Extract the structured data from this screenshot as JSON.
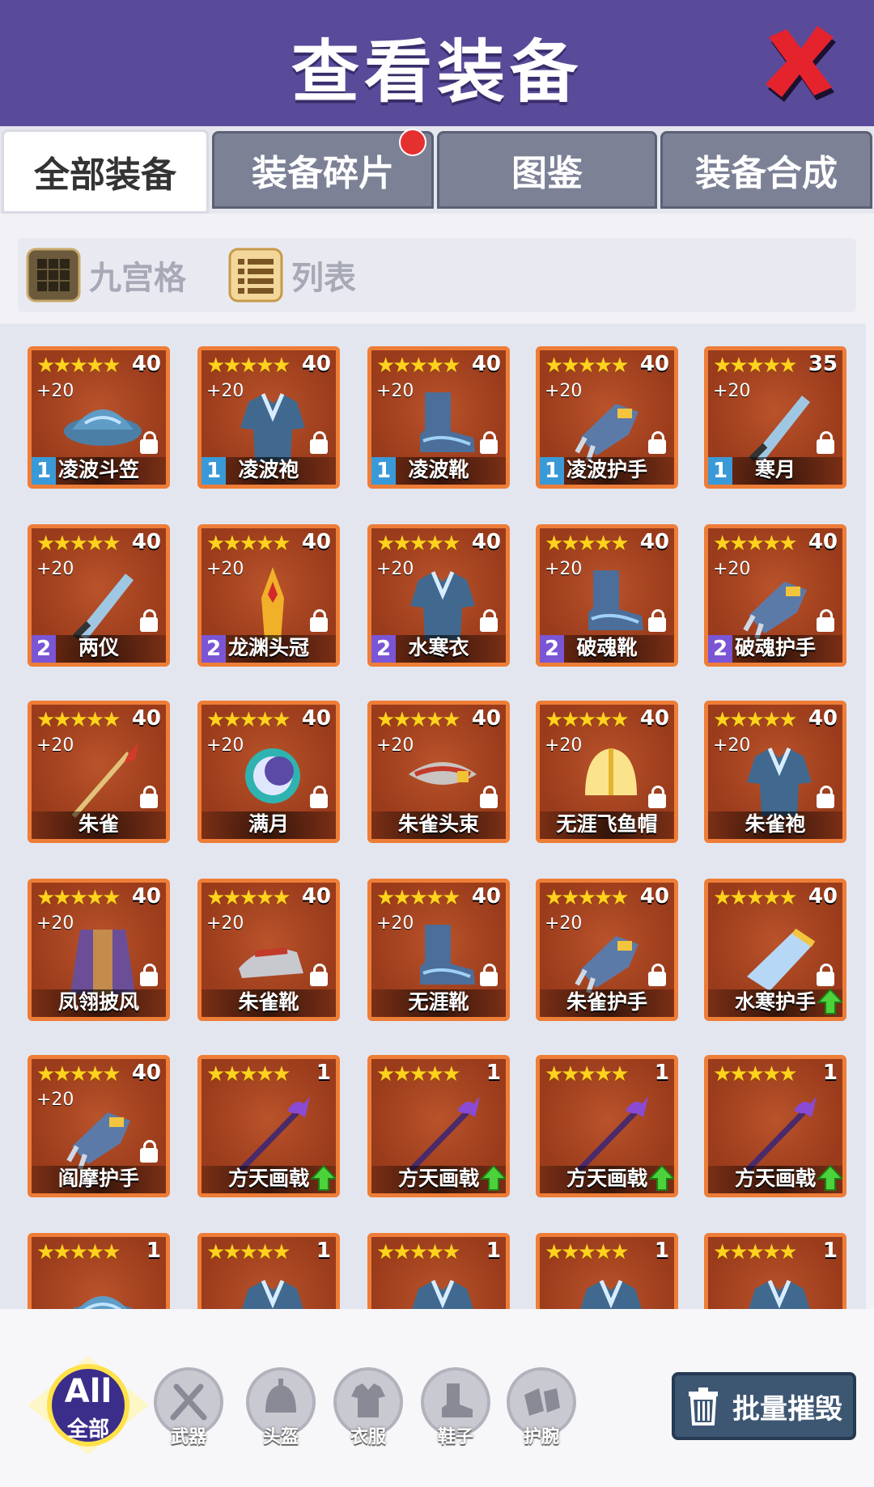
{
  "header": {
    "title": "查看装备"
  },
  "tabs": [
    {
      "label": "全部装备",
      "active": true
    },
    {
      "label": "装备碎片",
      "badge": true
    },
    {
      "label": "图鉴"
    },
    {
      "label": "装备合成"
    }
  ],
  "view_modes": [
    {
      "label": "九宫格",
      "icon": "grid-icon"
    },
    {
      "label": "列表",
      "icon": "list-icon"
    }
  ],
  "items": [
    {
      "name": "凌波斗笠",
      "level": "40",
      "enhance": "+20",
      "tier": "1",
      "stars": "★★★★★",
      "locked": true,
      "upgrade": false,
      "art": "hat"
    },
    {
      "name": "凌波袍",
      "level": "40",
      "enhance": "+20",
      "tier": "1",
      "stars": "★★★★★",
      "locked": true,
      "upgrade": false,
      "art": "robe"
    },
    {
      "name": "凌波靴",
      "level": "40",
      "enhance": "+20",
      "tier": "1",
      "stars": "★★★★★",
      "locked": true,
      "upgrade": false,
      "art": "boot"
    },
    {
      "name": "凌波护手",
      "level": "40",
      "enhance": "+20",
      "tier": "1",
      "stars": "★★★★★",
      "locked": true,
      "upgrade": false,
      "art": "glove"
    },
    {
      "name": "寒月",
      "level": "35",
      "enhance": "+20",
      "tier": "1",
      "stars": "★★★★★",
      "locked": true,
      "upgrade": false,
      "art": "sword"
    },
    {
      "name": "两仪",
      "level": "40",
      "enhance": "+20",
      "tier": "2",
      "stars": "★★★★★",
      "locked": true,
      "upgrade": false,
      "art": "sword"
    },
    {
      "name": "龙渊头冠",
      "level": "40",
      "enhance": "+20",
      "tier": "2",
      "stars": "★★★★★",
      "locked": true,
      "upgrade": false,
      "art": "crown"
    },
    {
      "name": "水寒衣",
      "level": "40",
      "enhance": "+20",
      "tier": "2",
      "stars": "★★★★★",
      "locked": true,
      "upgrade": false,
      "art": "robe"
    },
    {
      "name": "破魂靴",
      "level": "40",
      "enhance": "+20",
      "tier": "2",
      "stars": "★★★★★",
      "locked": true,
      "upgrade": false,
      "art": "boot"
    },
    {
      "name": "破魂护手",
      "level": "40",
      "enhance": "+20",
      "tier": "2",
      "stars": "★★★★★",
      "locked": true,
      "upgrade": false,
      "art": "glove"
    },
    {
      "name": "朱雀",
      "level": "40",
      "enhance": "+20",
      "tier": "",
      "stars": "★★★★★",
      "locked": true,
      "upgrade": false,
      "art": "spear"
    },
    {
      "name": "满月",
      "level": "40",
      "enhance": "+20",
      "tier": "",
      "stars": "★★★★★",
      "locked": true,
      "upgrade": false,
      "art": "moon"
    },
    {
      "name": "朱雀头束",
      "level": "40",
      "enhance": "+20",
      "tier": "",
      "stars": "★★★★★",
      "locked": true,
      "upgrade": false,
      "art": "band"
    },
    {
      "name": "无涯飞鱼帽",
      "level": "40",
      "enhance": "+20",
      "tier": "",
      "stars": "★★★★★",
      "locked": true,
      "upgrade": false,
      "art": "helmet"
    },
    {
      "name": "朱雀袍",
      "level": "40",
      "enhance": "+20",
      "tier": "",
      "stars": "★★★★★",
      "locked": true,
      "upgrade": false,
      "art": "robe"
    },
    {
      "name": "凤翎披风",
      "level": "40",
      "enhance": "+20",
      "tier": "",
      "stars": "★★★★★",
      "locked": true,
      "upgrade": false,
      "art": "cape"
    },
    {
      "name": "朱雀靴",
      "level": "40",
      "enhance": "+20",
      "tier": "",
      "stars": "★★★★★",
      "locked": true,
      "upgrade": false,
      "art": "shoe"
    },
    {
      "name": "无涯靴",
      "level": "40",
      "enhance": "+20",
      "tier": "",
      "stars": "★★★★★",
      "locked": true,
      "upgrade": false,
      "art": "boot"
    },
    {
      "name": "朱雀护手",
      "level": "40",
      "enhance": "+20",
      "tier": "",
      "stars": "★★★★★",
      "locked": true,
      "upgrade": false,
      "art": "glove"
    },
    {
      "name": "水寒护手",
      "level": "40",
      "enhance": "",
      "tier": "",
      "stars": "★★★★★",
      "locked": true,
      "upgrade": true,
      "art": "gem"
    },
    {
      "name": "阎摩护手",
      "level": "40",
      "enhance": "+20",
      "tier": "",
      "stars": "★★★★★",
      "locked": true,
      "upgrade": false,
      "art": "glove"
    },
    {
      "name": "方天画戟",
      "level": "1",
      "enhance": "",
      "tier": "",
      "stars": "★★★★★",
      "locked": false,
      "upgrade": true,
      "art": "halberd"
    },
    {
      "name": "方天画戟",
      "level": "1",
      "enhance": "",
      "tier": "",
      "stars": "★★★★★",
      "locked": false,
      "upgrade": true,
      "art": "halberd"
    },
    {
      "name": "方天画戟",
      "level": "1",
      "enhance": "",
      "tier": "",
      "stars": "★★★★★",
      "locked": false,
      "upgrade": true,
      "art": "halberd"
    },
    {
      "name": "方天画戟",
      "level": "1",
      "enhance": "",
      "tier": "",
      "stars": "★★★★★",
      "locked": false,
      "upgrade": true,
      "art": "halberd"
    },
    {
      "name": "",
      "level": "1",
      "enhance": "",
      "tier": "",
      "stars": "★★★★★",
      "locked": false,
      "upgrade": false,
      "art": "hat"
    },
    {
      "name": "",
      "level": "1",
      "enhance": "",
      "tier": "",
      "stars": "★★★★★",
      "locked": false,
      "upgrade": false,
      "art": "robe"
    },
    {
      "name": "",
      "level": "1",
      "enhance": "",
      "tier": "",
      "stars": "★★★★★",
      "locked": false,
      "upgrade": false,
      "art": "robe"
    },
    {
      "name": "",
      "level": "1",
      "enhance": "",
      "tier": "",
      "stars": "★★★★★",
      "locked": false,
      "upgrade": false,
      "art": "robe"
    },
    {
      "name": "",
      "level": "1",
      "enhance": "",
      "tier": "",
      "stars": "★★★★★",
      "locked": false,
      "upgrade": false,
      "art": "robe"
    }
  ],
  "filters": {
    "all": {
      "main": "All",
      "sub": "全部"
    },
    "categories": [
      {
        "label": "武器",
        "icon": "sword-icon"
      },
      {
        "label": "头盔",
        "icon": "helmet-icon"
      },
      {
        "label": "衣服",
        "icon": "clothes-icon"
      },
      {
        "label": "鞋子",
        "icon": "shoe-icon"
      },
      {
        "label": "护腕",
        "icon": "bracer-icon"
      }
    ]
  },
  "batch_destroy": {
    "label": "批量摧毁"
  },
  "colors": {
    "header": "#5a4a9a",
    "card": "#a3421f",
    "card_border": "#ee7d37",
    "stars": "#ffd21e"
  }
}
